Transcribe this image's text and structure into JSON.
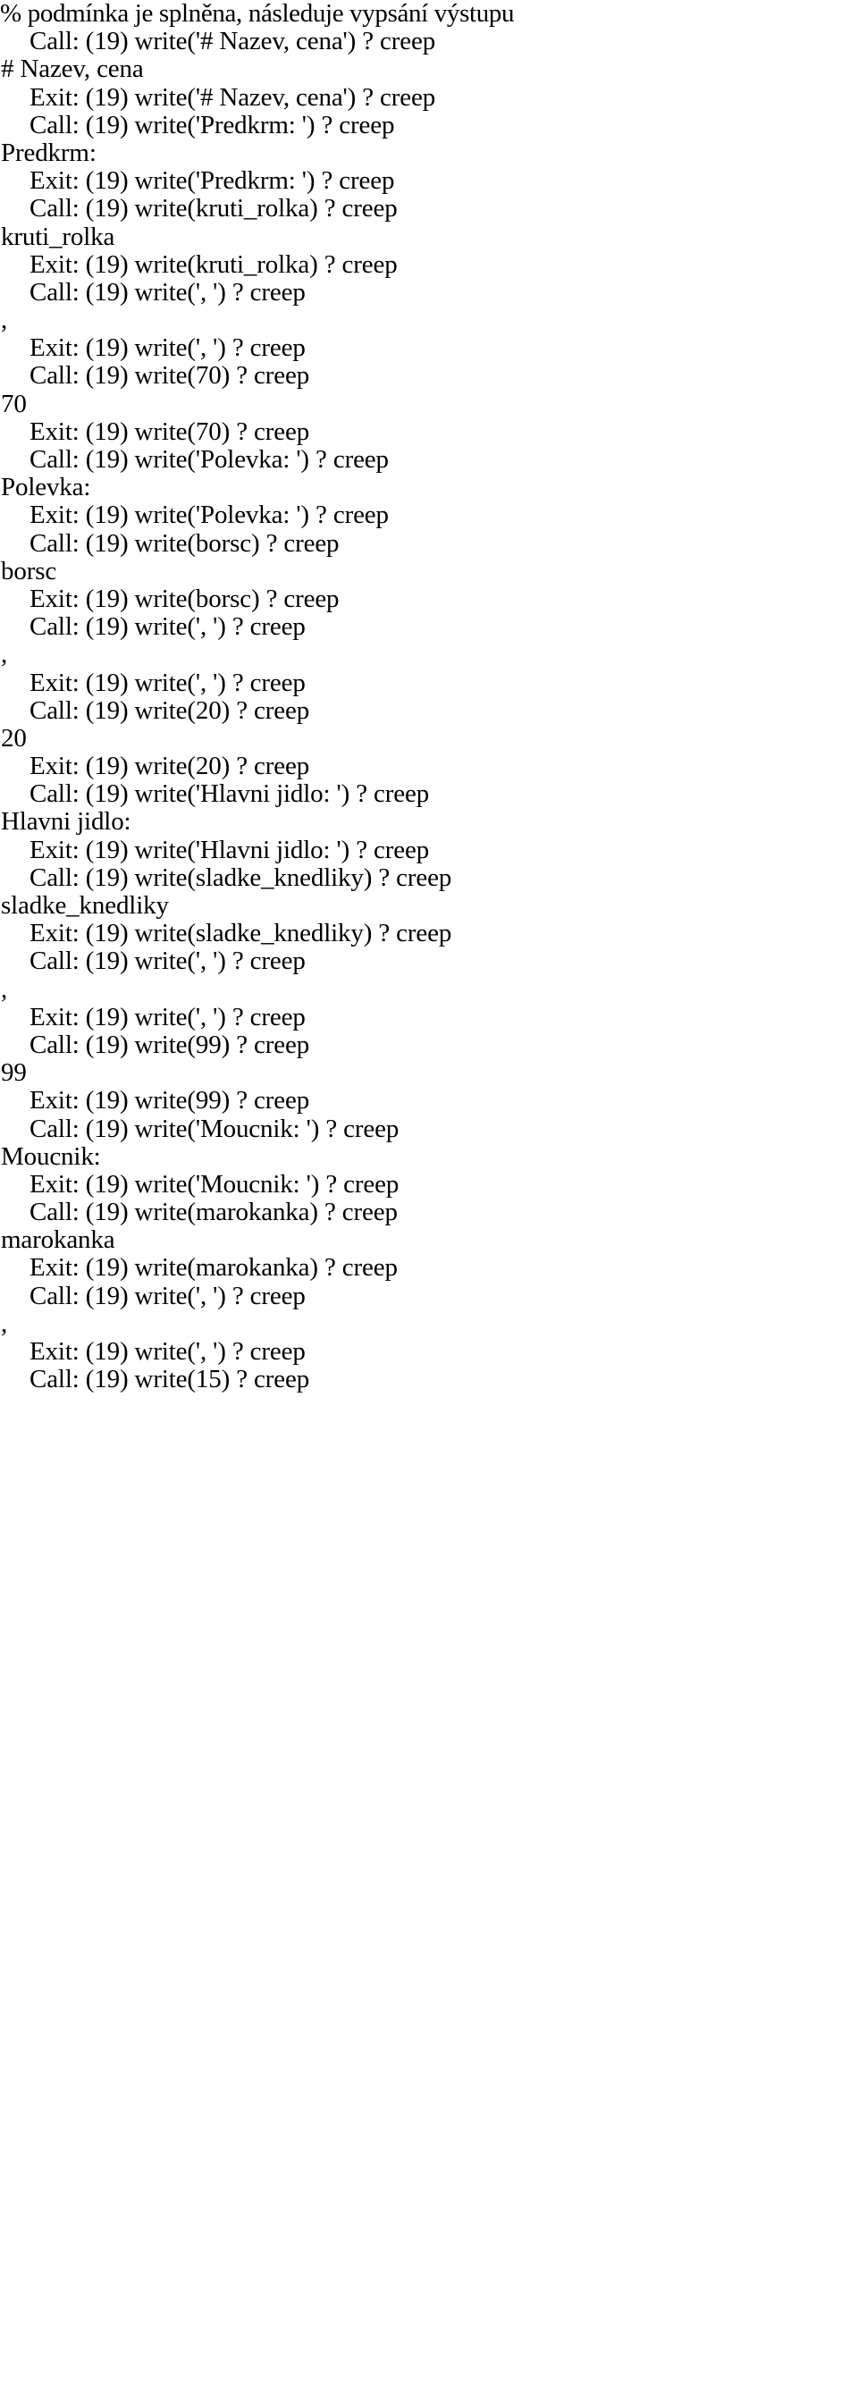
{
  "document": {
    "kind": "prolog-tracer-transcript",
    "text_color": "#000000",
    "background_color": "#ffffff",
    "lines": [
      {
        "indent": 0,
        "text": "% podmínka je splněna, následuje vypsání výstupu",
        "kind": "comment"
      },
      {
        "indent": 1,
        "text": "Call: (19) write('# Nazev, cena') ? creep",
        "kind": "port-call"
      },
      {
        "indent": 0,
        "text": "# Nazev, cena",
        "kind": "program-output"
      },
      {
        "indent": 1,
        "text": "Exit: (19) write('# Nazev, cena') ? creep",
        "kind": "port-exit"
      },
      {
        "indent": 1,
        "text": "Call: (19) write('Predkrm: ') ? creep",
        "kind": "port-call"
      },
      {
        "indent": 0,
        "text": "Predkrm:",
        "kind": "program-output"
      },
      {
        "indent": 1,
        "text": "Exit: (19) write('Predkrm: ') ? creep",
        "kind": "port-exit"
      },
      {
        "indent": 1,
        "text": "Call: (19) write(kruti_rolka) ? creep",
        "kind": "port-call"
      },
      {
        "indent": 0,
        "text": "kruti_rolka",
        "kind": "program-output"
      },
      {
        "indent": 1,
        "text": "Exit: (19) write(kruti_rolka) ? creep",
        "kind": "port-exit"
      },
      {
        "indent": 1,
        "text": "Call: (19) write(', ') ? creep",
        "kind": "port-call"
      },
      {
        "indent": 0,
        "text": ",",
        "kind": "program-output-comma"
      },
      {
        "indent": 1,
        "text": "Exit: (19) write(', ') ? creep",
        "kind": "port-exit"
      },
      {
        "indent": 1,
        "text": "Call: (19) write(70) ? creep",
        "kind": "port-call"
      },
      {
        "indent": 0,
        "text": "70",
        "kind": "program-output"
      },
      {
        "indent": 1,
        "text": "Exit: (19) write(70) ? creep",
        "kind": "port-exit"
      },
      {
        "indent": 1,
        "text": "Call: (19) write('Polevka: ') ? creep",
        "kind": "port-call"
      },
      {
        "indent": 0,
        "text": "Polevka:",
        "kind": "program-output"
      },
      {
        "indent": 1,
        "text": "Exit: (19) write('Polevka: ') ? creep",
        "kind": "port-exit"
      },
      {
        "indent": 1,
        "text": "Call: (19) write(borsc) ? creep",
        "kind": "port-call"
      },
      {
        "indent": 0,
        "text": "borsc",
        "kind": "program-output"
      },
      {
        "indent": 1,
        "text": "Exit: (19) write(borsc) ? creep",
        "kind": "port-exit"
      },
      {
        "indent": 1,
        "text": "Call: (19) write(', ') ? creep",
        "kind": "port-call"
      },
      {
        "indent": 0,
        "text": ",",
        "kind": "program-output-comma"
      },
      {
        "indent": 1,
        "text": "Exit: (19) write(', ') ? creep",
        "kind": "port-exit"
      },
      {
        "indent": 1,
        "text": "Call: (19) write(20) ? creep",
        "kind": "port-call"
      },
      {
        "indent": 0,
        "text": "20",
        "kind": "program-output"
      },
      {
        "indent": 1,
        "text": "Exit: (19) write(20) ? creep",
        "kind": "port-exit"
      },
      {
        "indent": 1,
        "text": "Call: (19) write('Hlavni jidlo: ') ? creep",
        "kind": "port-call"
      },
      {
        "indent": 0,
        "text": "Hlavni jidlo:",
        "kind": "program-output"
      },
      {
        "indent": 1,
        "text": "Exit: (19) write('Hlavni jidlo: ') ? creep",
        "kind": "port-exit"
      },
      {
        "indent": 1,
        "text": "Call: (19) write(sladke_knedliky) ? creep",
        "kind": "port-call"
      },
      {
        "indent": 0,
        "text": "sladke_knedliky",
        "kind": "program-output"
      },
      {
        "indent": 1,
        "text": "Exit: (19) write(sladke_knedliky) ? creep",
        "kind": "port-exit"
      },
      {
        "indent": 1,
        "text": "Call: (19) write(', ') ? creep",
        "kind": "port-call"
      },
      {
        "indent": 0,
        "text": ",",
        "kind": "program-output-comma"
      },
      {
        "indent": 1,
        "text": "Exit: (19) write(', ') ? creep",
        "kind": "port-exit"
      },
      {
        "indent": 1,
        "text": "Call: (19) write(99) ? creep",
        "kind": "port-call"
      },
      {
        "indent": 0,
        "text": "99",
        "kind": "program-output"
      },
      {
        "indent": 1,
        "text": "Exit: (19) write(99) ? creep",
        "kind": "port-exit"
      },
      {
        "indent": 1,
        "text": "Call: (19) write('Moucnik: ') ? creep",
        "kind": "port-call"
      },
      {
        "indent": 0,
        "text": "Moucnik:",
        "kind": "program-output"
      },
      {
        "indent": 1,
        "text": "Exit: (19) write('Moucnik: ') ? creep",
        "kind": "port-exit"
      },
      {
        "indent": 1,
        "text": "Call: (19) write(marokanka) ? creep",
        "kind": "port-call"
      },
      {
        "indent": 0,
        "text": "marokanka",
        "kind": "program-output"
      },
      {
        "indent": 1,
        "text": "Exit: (19) write(marokanka) ? creep",
        "kind": "port-exit"
      },
      {
        "indent": 1,
        "text": "Call: (19) write(', ') ? creep",
        "kind": "port-call"
      },
      {
        "indent": 0,
        "text": ",",
        "kind": "program-output-comma"
      },
      {
        "indent": 1,
        "text": "Exit: (19) write(', ') ? creep",
        "kind": "port-exit"
      },
      {
        "indent": 1,
        "text": "Call: (19) write(15) ? creep",
        "kind": "port-call"
      }
    ]
  }
}
